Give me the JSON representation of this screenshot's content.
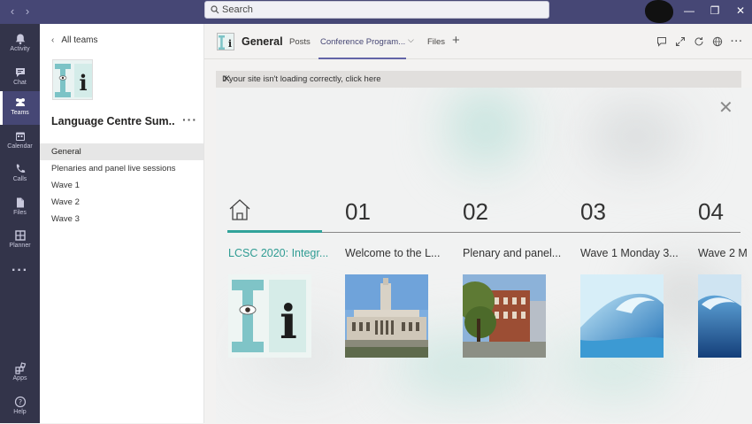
{
  "titlebar": {
    "search_placeholder": "Search",
    "back_icon": "chevron-left-icon",
    "forward_icon": "chevron-right-icon"
  },
  "rail": {
    "items": [
      {
        "label": "Activity",
        "icon": "bell-icon"
      },
      {
        "label": "Chat",
        "icon": "chat-icon"
      },
      {
        "label": "Teams",
        "icon": "teams-icon"
      },
      {
        "label": "Calendar",
        "icon": "calendar-icon"
      },
      {
        "label": "Calls",
        "icon": "phone-icon"
      },
      {
        "label": "Files",
        "icon": "files-icon"
      },
      {
        "label": "Planner",
        "icon": "planner-icon"
      },
      {
        "label": "Apps",
        "icon": "apps-icon"
      },
      {
        "label": "Help",
        "icon": "help-icon"
      }
    ],
    "active": "Teams"
  },
  "teampanel": {
    "all_teams": "All teams",
    "team_name": "Language Centre Sum...",
    "channels": [
      "General",
      "Plenaries and panel live sessions",
      "Wave 1",
      "Wave 2",
      "Wave 3"
    ]
  },
  "header": {
    "channel": "General",
    "tabs": [
      "Posts",
      "Conference Program...",
      "Files"
    ],
    "active_tab": "Conference Program..."
  },
  "banner": {
    "text": "If your site isn't loading correctly, click here"
  },
  "content": {
    "nav_numbers": [
      "01",
      "02",
      "03",
      "04"
    ],
    "cards": [
      {
        "title": "LCSC 2020: Integr..."
      },
      {
        "title": "Welcome to the L..."
      },
      {
        "title": "Plenary and panel..."
      },
      {
        "title": "Wave 1 Monday 3..."
      },
      {
        "title": "Wave 2 M"
      }
    ],
    "accent": "#31a39a"
  },
  "colors": {
    "titlebar": "#464775",
    "rail": "#33344a",
    "accent": "#6264a7"
  }
}
